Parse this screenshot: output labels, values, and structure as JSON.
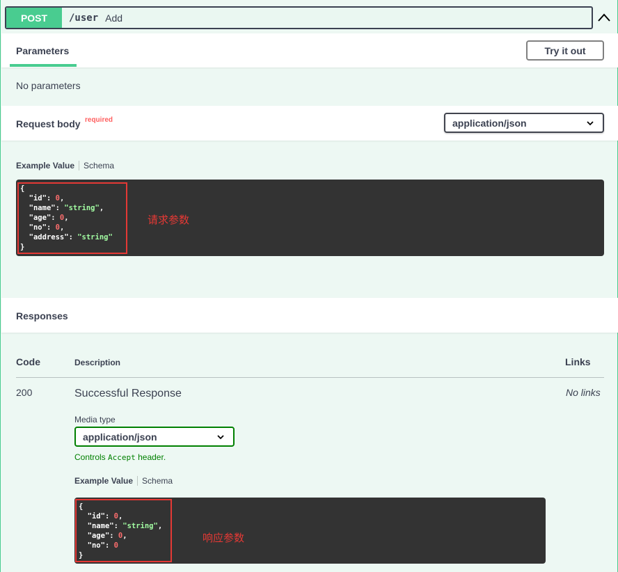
{
  "operation": {
    "method": "POST",
    "path": "/user",
    "summary": "Add"
  },
  "parameters": {
    "tab_label": "Parameters",
    "try_button": "Try it out",
    "empty_text": "No parameters"
  },
  "request_body": {
    "title": "Request body",
    "required_label": "required",
    "content_type": "application/json",
    "example_tab": "Example Value",
    "schema_tab": "Schema",
    "annotation": "请求参数"
  },
  "responses": {
    "title": "Responses",
    "columns": {
      "code": "Code",
      "description": "Description",
      "links": "Links"
    },
    "items": [
      {
        "code": "200",
        "description": "Successful Response",
        "links": "No links",
        "media_type_label": "Media type",
        "media_type": "application/json",
        "controls_prefix": "Controls ",
        "controls_mono": "Accept",
        "controls_suffix": " header.",
        "example_tab": "Example Value",
        "schema_tab": "Schema",
        "annotation": "响应参数"
      }
    ]
  },
  "colors": {
    "post_green": "#49cc90",
    "highlight_red": "#e53935",
    "code_bg": "#333333"
  },
  "icons": {
    "collapse": "chevron-up-icon",
    "select": "chevron-down-icon"
  }
}
